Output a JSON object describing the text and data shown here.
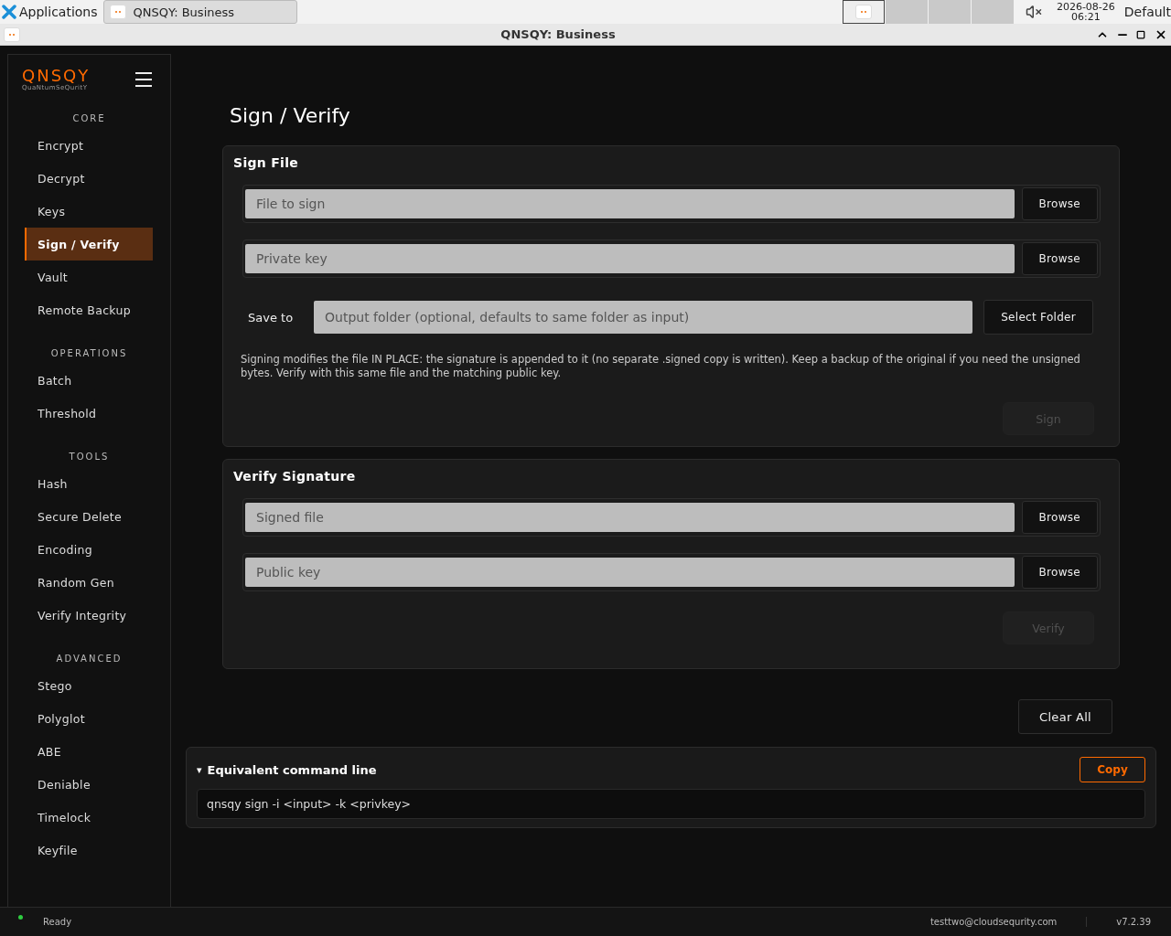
{
  "taskbar": {
    "menu": "Applications",
    "tasks": [
      {
        "title": "QNSQY: Business",
        "selected": true
      }
    ],
    "date": "2026-08-26",
    "time": "06:21",
    "layout": "Default"
  },
  "window": {
    "title": "QNSQY: Business"
  },
  "sidebar": {
    "logo": "QNSQY",
    "tagline": "QuaNtumSeQuritY",
    "sections": [
      {
        "title": "CORE",
        "items": [
          {
            "label": "Encrypt",
            "selected": false
          },
          {
            "label": "Decrypt",
            "selected": false
          },
          {
            "label": "Keys",
            "selected": false
          },
          {
            "label": "Sign / Verify",
            "selected": true
          },
          {
            "label": "Vault",
            "selected": false
          },
          {
            "label": "Remote Backup",
            "selected": false
          }
        ]
      },
      {
        "title": "OPERATIONS",
        "items": [
          {
            "label": "Batch",
            "selected": false
          },
          {
            "label": "Threshold",
            "selected": false
          }
        ]
      },
      {
        "title": "TOOLS",
        "items": [
          {
            "label": "Hash",
            "selected": false
          },
          {
            "label": "Secure Delete",
            "selected": false
          },
          {
            "label": "Encoding",
            "selected": false
          },
          {
            "label": "Random Gen",
            "selected": false
          },
          {
            "label": "Verify Integrity",
            "selected": false
          }
        ]
      },
      {
        "title": "ADVANCED",
        "items": [
          {
            "label": "Stego",
            "selected": false
          },
          {
            "label": "Polyglot",
            "selected": false
          },
          {
            "label": "ABE",
            "selected": false
          },
          {
            "label": "Deniable",
            "selected": false
          },
          {
            "label": "Timelock",
            "selected": false
          },
          {
            "label": "Keyfile",
            "selected": false
          }
        ]
      }
    ]
  },
  "page": {
    "title": "Sign / Verify"
  },
  "sign_file": {
    "title": "Sign File",
    "fields": [
      {
        "placeholder": "File to sign",
        "button": "Browse"
      },
      {
        "placeholder": "Private key",
        "button": "Browse"
      }
    ],
    "save_to": {
      "label": "Save to",
      "placeholder": "Output folder (optional, defaults to same folder as input)",
      "button": "Select Folder"
    },
    "note": "Signing modifies the file IN PLACE: the signature is appended to it (no separate .signed copy is written). Keep a backup of the original if you need the unsigned bytes. Verify with this same file and the matching public key.",
    "action": {
      "label": "Sign",
      "disabled": true
    }
  },
  "verify_signature": {
    "title": "Verify Signature",
    "fields": [
      {
        "placeholder": "Signed file",
        "button": "Browse"
      },
      {
        "placeholder": "Public key",
        "button": "Browse"
      }
    ],
    "action": {
      "label": "Verify",
      "disabled": true
    }
  },
  "clear_button": "Clear All",
  "command_line": {
    "caret": "▾",
    "title": "Equivalent command line",
    "expanded": true,
    "copy": "Copy",
    "command": "qnsqy sign -i <input> -k <privkey>"
  },
  "status_bar": {
    "status": "Ready",
    "user": "testtwo@cloudsequrity.com",
    "version": "v7.2.39"
  }
}
